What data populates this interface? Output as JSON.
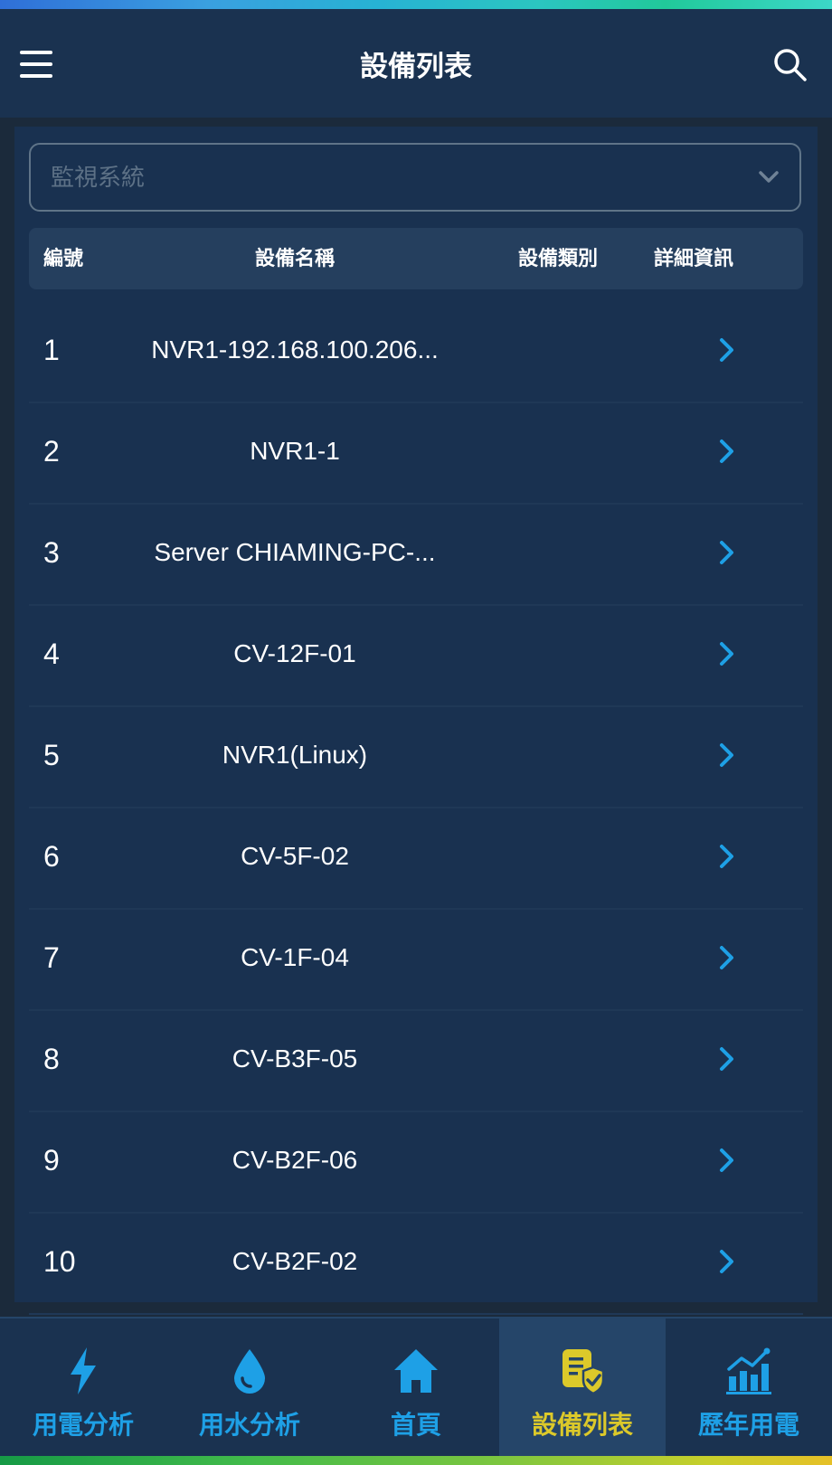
{
  "header": {
    "title": "設備列表"
  },
  "filter": {
    "placeholder": "監視系統"
  },
  "table": {
    "columns": [
      "編號",
      "設備名稱",
      "設備類別",
      "詳細資訊"
    ],
    "rows": [
      {
        "number": "1",
        "name": "NVR1-192.168.100.206...",
        "category": ""
      },
      {
        "number": "2",
        "name": "NVR1-1",
        "category": ""
      },
      {
        "number": "3",
        "name": "Server CHIAMING-PC-...",
        "category": ""
      },
      {
        "number": "4",
        "name": "CV-12F-01",
        "category": ""
      },
      {
        "number": "5",
        "name": "NVR1(Linux)",
        "category": ""
      },
      {
        "number": "6",
        "name": "CV-5F-02",
        "category": ""
      },
      {
        "number": "7",
        "name": "CV-1F-04",
        "category": ""
      },
      {
        "number": "8",
        "name": "CV-B3F-05",
        "category": ""
      },
      {
        "number": "9",
        "name": "CV-B2F-06",
        "category": ""
      },
      {
        "number": "10",
        "name": "CV-B2F-02",
        "category": ""
      }
    ]
  },
  "nav": {
    "items": [
      {
        "label": "用電分析",
        "icon": "lightning-icon"
      },
      {
        "label": "用水分析",
        "icon": "water-drop-icon"
      },
      {
        "label": "首頁",
        "icon": "home-icon"
      },
      {
        "label": "設備列表",
        "icon": "device-list-shield-icon",
        "active": true
      },
      {
        "label": "歷年用電",
        "icon": "bar-chart-icon"
      }
    ]
  },
  "colors": {
    "header_bg": "#1a3250",
    "panel_bg": "#193150",
    "accent_blue": "#1ea0e6",
    "active_yellow": "#dcc92a"
  }
}
